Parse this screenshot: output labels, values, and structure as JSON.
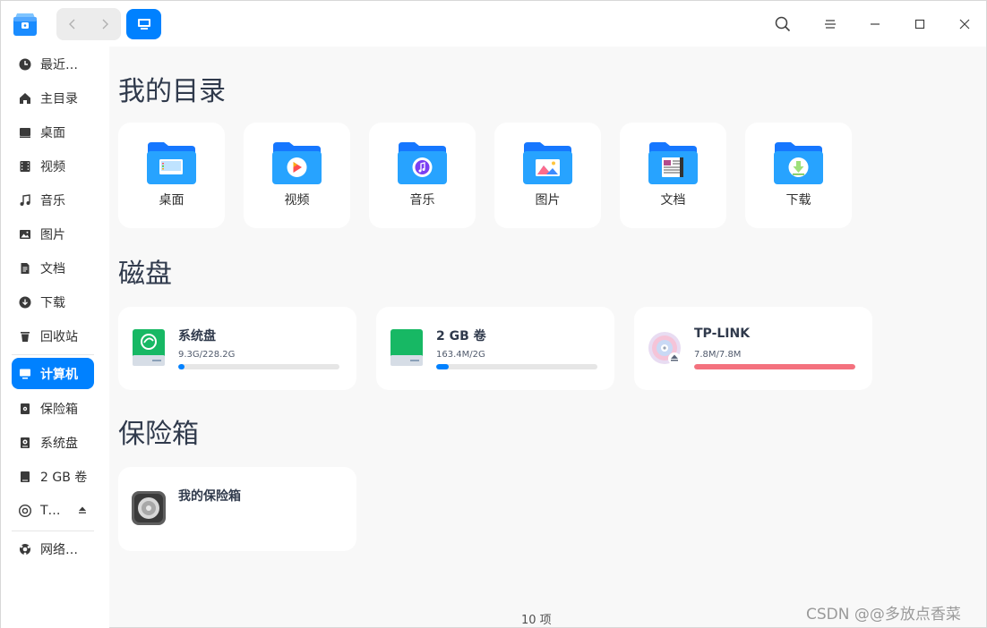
{
  "window": {
    "current_location_icon": "computer-icon"
  },
  "titlebar": {
    "back_icon": "chevron-left-icon",
    "forward_icon": "chevron-right-icon",
    "search_icon": "search-icon",
    "menu_icon": "menu-icon",
    "minimize_icon": "minimize-icon",
    "maximize_icon": "maximize-icon",
    "close_icon": "close-icon"
  },
  "sidebar": {
    "items": [
      {
        "label": "最近…",
        "icon": "clock-icon"
      },
      {
        "label": "主目录",
        "icon": "home-icon"
      },
      {
        "label": "桌面",
        "icon": "desktop-icon"
      },
      {
        "label": "视频",
        "icon": "video-icon"
      },
      {
        "label": "音乐",
        "icon": "music-icon"
      },
      {
        "label": "图片",
        "icon": "image-icon"
      },
      {
        "label": "文档",
        "icon": "document-icon"
      },
      {
        "label": "下载",
        "icon": "download-icon"
      },
      {
        "label": "回收站",
        "icon": "trash-icon"
      },
      {
        "label": "计算机",
        "icon": "computer-icon",
        "active": true
      },
      {
        "label": "保险箱",
        "icon": "vault-icon"
      },
      {
        "label": "系统盘",
        "icon": "disk-icon"
      },
      {
        "label": "2 GB 卷",
        "icon": "disk-icon"
      },
      {
        "label": "T…",
        "icon": "disc-icon",
        "eject": true
      },
      {
        "label": "网络…",
        "icon": "network-icon"
      }
    ]
  },
  "main": {
    "sections": {
      "dirs_title": "我的目录",
      "disks_title": "磁盘",
      "vault_title": "保险箱"
    },
    "dirs": [
      {
        "label": "桌面",
        "icon": "desktop-folder-icon"
      },
      {
        "label": "视频",
        "icon": "video-folder-icon"
      },
      {
        "label": "音乐",
        "icon": "music-folder-icon"
      },
      {
        "label": "图片",
        "icon": "picture-folder-icon"
      },
      {
        "label": "文档",
        "icon": "document-folder-icon"
      },
      {
        "label": "下载",
        "icon": "download-folder-icon"
      }
    ],
    "disks": [
      {
        "name": "系统盘",
        "size": "9.3G/228.2G",
        "usage": 0.04,
        "color": "#0081ff",
        "icon": "system-disk-icon"
      },
      {
        "name": "2 GB 卷",
        "size": "163.4M/2G",
        "usage": 0.08,
        "color": "#0081ff",
        "icon": "disk-icon"
      },
      {
        "name": "TP-LINK",
        "size": "7.8M/7.8M",
        "usage": 1.0,
        "color": "#f4717e",
        "icon": "optical-disc-icon"
      }
    ],
    "vault": {
      "name": "我的保险箱",
      "icon": "safe-icon"
    }
  },
  "status": {
    "item_count": "10 项"
  },
  "watermark": "CSDN @@多放点香菜"
}
